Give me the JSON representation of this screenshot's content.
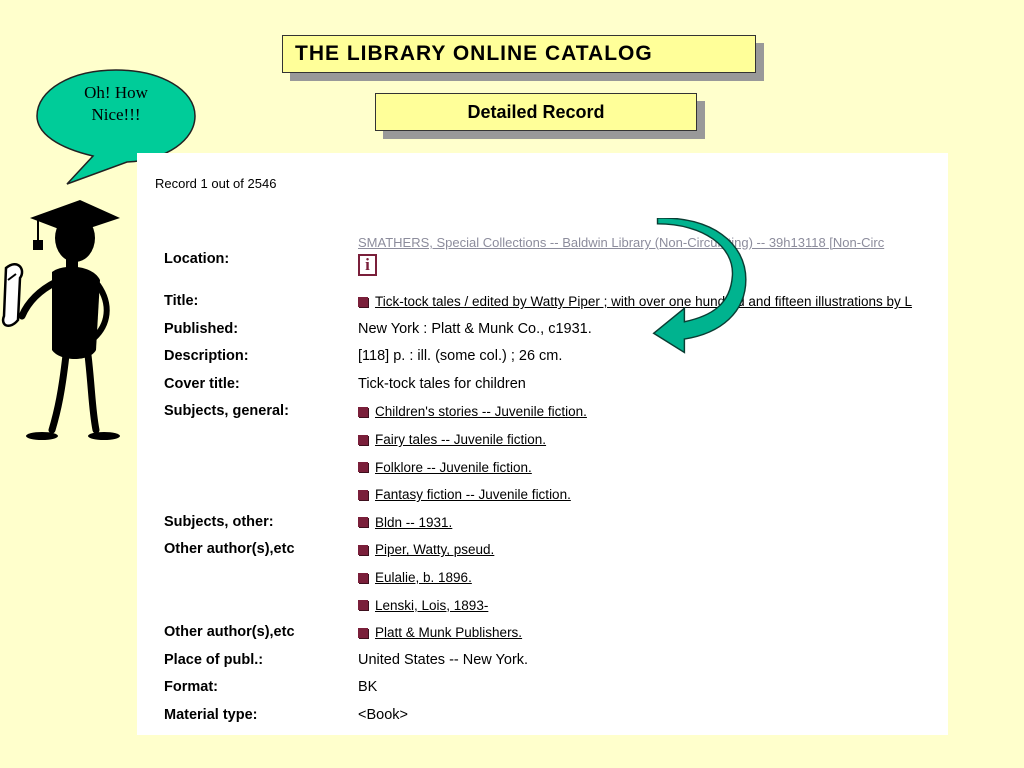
{
  "header": {
    "title": "THE  LIBRARY  ONLINE  CATALOG",
    "subtitle": "Detailed Record"
  },
  "speech_bubble": {
    "text_line1": "Oh! How",
    "text_line2": "Nice!!!"
  },
  "record": {
    "count_text": "Record 1 out of 2546",
    "location_label": "Location:",
    "location_link": "SMATHERS, Special Collections -- Baldwin Library (Non-Circulating) -- 39h13118 [Non-Circ",
    "info_icon": "i",
    "rows": [
      {
        "label": "Title:",
        "value": "Tick-tock tales /  edited by Watty Piper ; with over one hundred and fifteen illustrations by L",
        "link": true
      },
      {
        "label": "Published:",
        "value": "New York :  Platt & Munk Co.,  c1931.",
        "link": false
      },
      {
        "label": "Description:",
        "value": "[118] p. : ill. (some col.) ; 26 cm.",
        "link": false
      },
      {
        "label": "Cover title:",
        "value": "Tick-tock tales for children",
        "link": false
      },
      {
        "label": "Subjects, general:",
        "value": "Children's stories -- Juvenile fiction.",
        "link": true
      },
      {
        "label": "",
        "value": "Fairy tales -- Juvenile fiction.",
        "link": true
      },
      {
        "label": "",
        "value": "Folklore -- Juvenile fiction.",
        "link": true
      },
      {
        "label": "",
        "value": "Fantasy fiction -- Juvenile fiction.",
        "link": true
      },
      {
        "label": "Subjects, other:",
        "value": "Bldn -- 1931.",
        "link": true
      },
      {
        "label": "Other author(s),etc",
        "value": "Piper, Watty, pseud.",
        "link": true
      },
      {
        "label": "",
        "value": "Eulalie, b. 1896.",
        "link": true
      },
      {
        "label": "",
        "value": "Lenski, Lois, 1893-",
        "link": true
      },
      {
        "label": "Other author(s),etc",
        "value": "Platt & Munk Publishers.",
        "link": true
      },
      {
        "label": "Place of publ.:",
        "value": "United States -- New York.",
        "link": false
      },
      {
        "label": "Format:",
        "value": "BK",
        "link": false
      },
      {
        "label": "Material type:",
        "value": "<Book>",
        "link": false
      }
    ]
  },
  "colors": {
    "background": "#ffffcc",
    "box_fill": "#ffff99",
    "bubble": "#00cc99",
    "arrow": "#00b38f",
    "bullet": "#7a1f3a"
  },
  "icons": [
    "speech-bubble",
    "student-figure-icon",
    "curved-arrow-icon",
    "info-icon",
    "bullet-icon"
  ]
}
